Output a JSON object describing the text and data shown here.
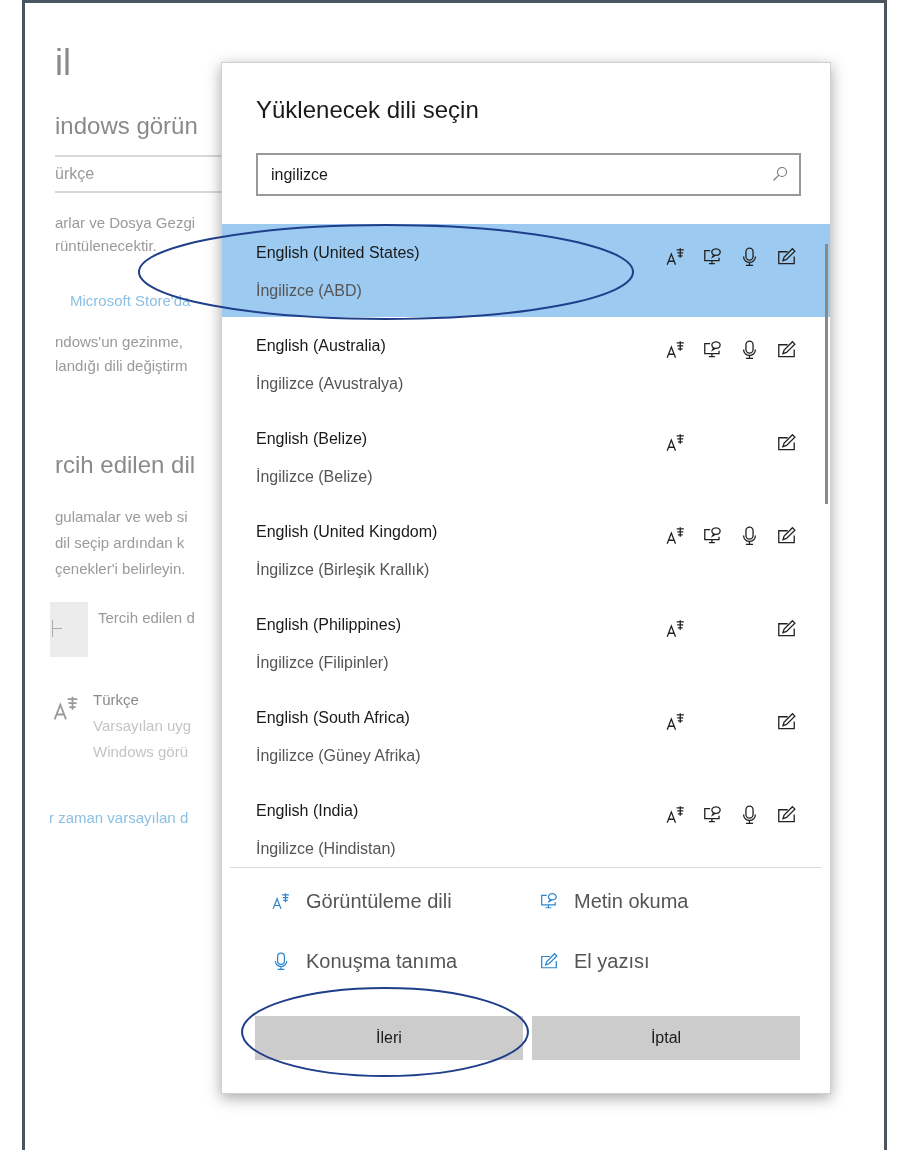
{
  "background": {
    "title": "il",
    "subtitle": "indows görün",
    "language_field": "ürkçe",
    "description_lines": [
      "arlar ve Dosya Gezgi",
      "rüntülenecektir."
    ],
    "store_link": "Microsoft Store'da",
    "info_lines": [
      "ndows'un gezinme,",
      "landığı dili değiştirm"
    ],
    "preferred_heading": "rcih edilen dil",
    "preferred_lines": [
      "gulamalar ve web si",
      "dil seçip ardından k",
      "çenekler'i belirleyin."
    ],
    "add_label": "Tercih edilen d",
    "languages": [
      {
        "name": "Türkçe",
        "details": [
          "Varsayılan uyg",
          "Windows görü"
        ]
      }
    ],
    "footer_link": "r zaman varsayılan d"
  },
  "dialog": {
    "title": "Yüklenecek dili seçin",
    "search": {
      "value": "ingilizce"
    },
    "languages": [
      {
        "name": "English (United States)",
        "native": "İngilizce (ABD)",
        "selected": true,
        "display": true,
        "text_to_speech": true,
        "speech": true,
        "handwriting": true
      },
      {
        "name": "English (Australia)",
        "native": "İngilizce (Avustralya)",
        "selected": false,
        "display": true,
        "text_to_speech": true,
        "speech": true,
        "handwriting": true
      },
      {
        "name": "English (Belize)",
        "native": "İngilizce (Belize)",
        "selected": false,
        "display": true,
        "text_to_speech": false,
        "speech": false,
        "handwriting": true
      },
      {
        "name": "English (United Kingdom)",
        "native": "İngilizce (Birleşik Krallık)",
        "selected": false,
        "display": true,
        "text_to_speech": true,
        "speech": true,
        "handwriting": true
      },
      {
        "name": "English (Philippines)",
        "native": "İngilizce (Filipinler)",
        "selected": false,
        "display": true,
        "text_to_speech": false,
        "speech": false,
        "handwriting": true
      },
      {
        "name": "English (South Africa)",
        "native": "İngilizce (Güney Afrika)",
        "selected": false,
        "display": true,
        "text_to_speech": false,
        "speech": false,
        "handwriting": true
      },
      {
        "name": "English (India)",
        "native": "İngilizce (Hindistan)",
        "selected": false,
        "display": true,
        "text_to_speech": true,
        "speech": true,
        "handwriting": true
      }
    ],
    "legend": [
      {
        "kind": "display",
        "label": "Görüntüleme dili"
      },
      {
        "kind": "text_to_speech",
        "label": "Metin okuma"
      },
      {
        "kind": "speech",
        "label": "Konuşma tanıma"
      },
      {
        "kind": "handwriting",
        "label": "El yazısı"
      }
    ],
    "buttons": [
      {
        "label": "İleri"
      },
      {
        "label": "İptal"
      }
    ]
  }
}
